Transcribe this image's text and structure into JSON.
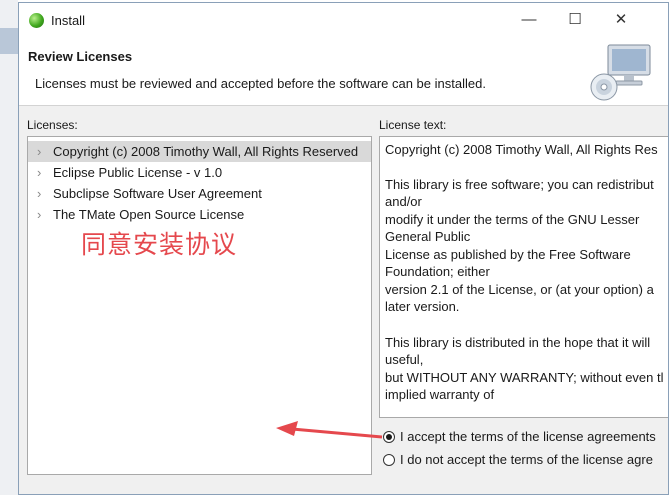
{
  "window": {
    "title": "Install",
    "minimize_symbol": "—",
    "maximize_symbol": "☐",
    "close_symbol": "✕"
  },
  "header": {
    "title": "Review Licenses",
    "subtitle": "Licenses must be reviewed and accepted before the software can be installed."
  },
  "licenses": {
    "label": "Licenses:",
    "items": [
      {
        "label": "Copyright (c) 2008 Timothy Wall, All Rights Reserved",
        "selected": true
      },
      {
        "label": "Eclipse Public License - v 1.0",
        "selected": false
      },
      {
        "label": "Subclipse Software User Agreement",
        "selected": false
      },
      {
        "label": "The TMate Open Source License",
        "selected": false
      }
    ]
  },
  "license_text": {
    "label": "License text:",
    "lines": [
      "Copyright (c) 2008 Timothy Wall, All Rights Res",
      "",
      "This library is free software; you can redistribut",
      "and/or",
      "modify it under the terms of the GNU Lesser",
      "General Public",
      "License as published by the Free Software",
      "Foundation; either",
      "version 2.1 of the License, or (at your option) a",
      "later version.",
      "",
      "This library is distributed in the hope that it will",
      "useful,",
      "but WITHOUT ANY WARRANTY; without even tl",
      "implied warranty of"
    ]
  },
  "acceptance": {
    "accept_label": "I accept the terms of the license agreements",
    "decline_label": "I do not accept the terms of the license agre",
    "selected": "accept"
  },
  "annotation": {
    "text": "同意安装协议",
    "color": "#e5484d"
  },
  "icons": {
    "chevron": "›"
  }
}
